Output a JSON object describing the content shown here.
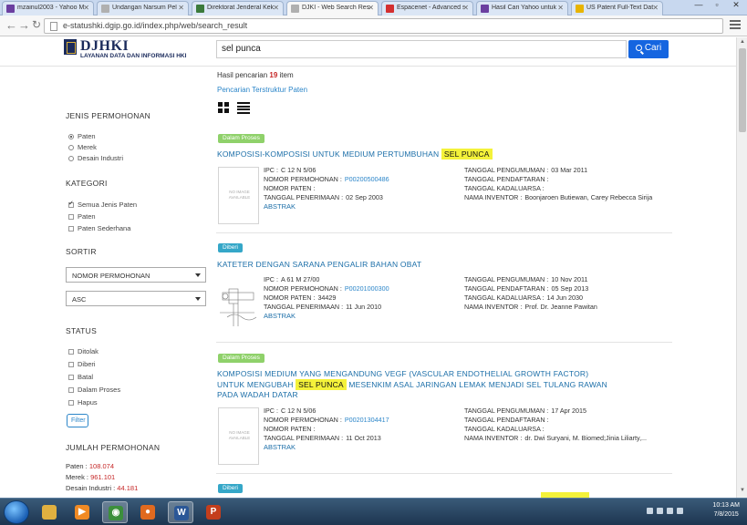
{
  "browser": {
    "tabs": [
      {
        "label": "mzainul2003 - Yahoo M",
        "color": "#6b3fa0"
      },
      {
        "label": "Undangan Narsum Pel",
        "color": "#b0b0b0"
      },
      {
        "label": "Direktorat Jenderal Kek",
        "color": "#3b7a3b"
      },
      {
        "label": "DJKI - Web Search Resu",
        "color": "#b0b0b0",
        "active": true
      },
      {
        "label": "Espacenet - Advanced s",
        "color": "#d32f2f"
      },
      {
        "label": "Hasil Cari Yahoo untuk",
        "color": "#6b3fa0"
      },
      {
        "label": "US Patent Full-Text Dat",
        "color": "#e8b400"
      }
    ],
    "url": "e-statushki.dgip.go.id/index.php/web/search_result",
    "window_controls": [
      "—",
      "▫",
      "✕"
    ]
  },
  "header": {
    "brand": "DJHKI",
    "subtitle": "LAYANAN DATA DAN INFORMASI HKI",
    "search_value": "sel punca",
    "search_button": "Cari"
  },
  "summary": {
    "prefix": "Hasil pencarian",
    "count": "19",
    "suffix": "item",
    "structured_link": "Pencarian Terstruktur Paten"
  },
  "sidebar": {
    "jenis_title": "JENIS PERMOHONAN",
    "jenis_options": [
      {
        "label": "Paten",
        "selected": true
      },
      {
        "label": "Merek",
        "selected": false
      },
      {
        "label": "Desain Industri",
        "selected": false
      }
    ],
    "kategori_title": "KATEGORI",
    "kategori_options": [
      {
        "label": "Semua Jenis Paten",
        "checked": true
      },
      {
        "label": "Paten",
        "checked": false
      },
      {
        "label": "Paten Sederhana",
        "checked": false
      }
    ],
    "sortir_title": "SORTIR",
    "sort_field": "NOMOR PERMOHONAN",
    "sort_order": "ASC",
    "status_title": "STATUS",
    "status_options": [
      "Ditolak",
      "Diberi",
      "Batal",
      "Dalam Proses",
      "Hapus"
    ],
    "filter_button": "Filter",
    "jumlah_title": "JUMLAH PERMOHONAN",
    "counts": [
      {
        "label": "Paten :",
        "value": "108.074"
      },
      {
        "label": "Merek :",
        "value": "961.101"
      },
      {
        "label": "Desain Industri :",
        "value": "44.181"
      }
    ]
  },
  "labels": {
    "ipc": "IPC :",
    "nomor_permohonan": "NOMOR PERMOHONAN :",
    "nomor_paten": "NOMOR PATEN :",
    "tanggal_penerimaan": "TANGGAL PENERIMAAN :",
    "tanggal_pengumuman": "TANGGAL PENGUMUMAN :",
    "tanggal_pendaftaran": "TANGGAL PENDAFTARAN :",
    "tanggal_kadaluarsa": "TANGGAL KADALUARSA :",
    "nama_inventor": "NAMA INVENTOR :",
    "abstrak": "ABSTRAK",
    "no_image": "NO IMAGE AVAILABLE"
  },
  "results": [
    {
      "status": "Dalam Proses",
      "title_before": "KOMPOSISI-KOMPOSISI UNTUK MEDIUM PERTUMBUHAN",
      "title_highlight": "SEL PUNCA",
      "title_after": "",
      "ipc": "C 12 N 5/06",
      "nomor_permohonan": "P00200500486",
      "nomor_paten": "",
      "tanggal_penerimaan": "02 Sep 2003",
      "tanggal_pengumuman": "03 Mar 2011",
      "tanggal_pendaftaran": "",
      "tanggal_kadaluarsa": "",
      "nama_inventor": "Boonjaroen Butiewan, Carey Rebecca Sirija"
    },
    {
      "status": "Diberi",
      "title_before": "KATETER DENGAN SARANA PENGALIR BAHAN OBAT",
      "title_highlight": "",
      "title_after": "",
      "ipc": "A 61 M 27/00",
      "nomor_permohonan": "P00201000300",
      "nomor_paten": "34429",
      "tanggal_penerimaan": "11 Jun 2010",
      "tanggal_pengumuman": "10 Nov 2011",
      "tanggal_pendaftaran": "05 Sep 2013",
      "tanggal_kadaluarsa": "14 Jun 2030",
      "nama_inventor": "Prof. Dr. Jeanne Pawitan"
    },
    {
      "status": "Dalam Proses",
      "title_before": "KOMPOSISI MEDIUM YANG MENGANDUNG VEGF (VASCULAR ENDOTHELIAL GROWTH FACTOR) UNTUK MENGUBAH",
      "title_highlight": "SEL PUNCA",
      "title_after": "MESENKIM ASAL JARINGAN LEMAK MENJADI SEL TULANG RAWAN PADA WADAH DATAR",
      "ipc": "C 12 N 5/06",
      "nomor_permohonan": "P00201304417",
      "nomor_paten": "",
      "tanggal_penerimaan": "11 Oct 2013",
      "tanggal_pengumuman": "17 Apr 2015",
      "tanggal_pendaftaran": "",
      "tanggal_kadaluarsa": "",
      "nama_inventor": "dr. Dwi Suryani, M. Biomed;Jinia Liliarty,..."
    },
    {
      "status": "Diberi"
    }
  ],
  "taskbar": {
    "time": "10:13 AM",
    "date": "7/8/2015",
    "apps": [
      "explorer",
      "media",
      "chrome",
      "firefox",
      "word",
      "powerpoint"
    ]
  }
}
